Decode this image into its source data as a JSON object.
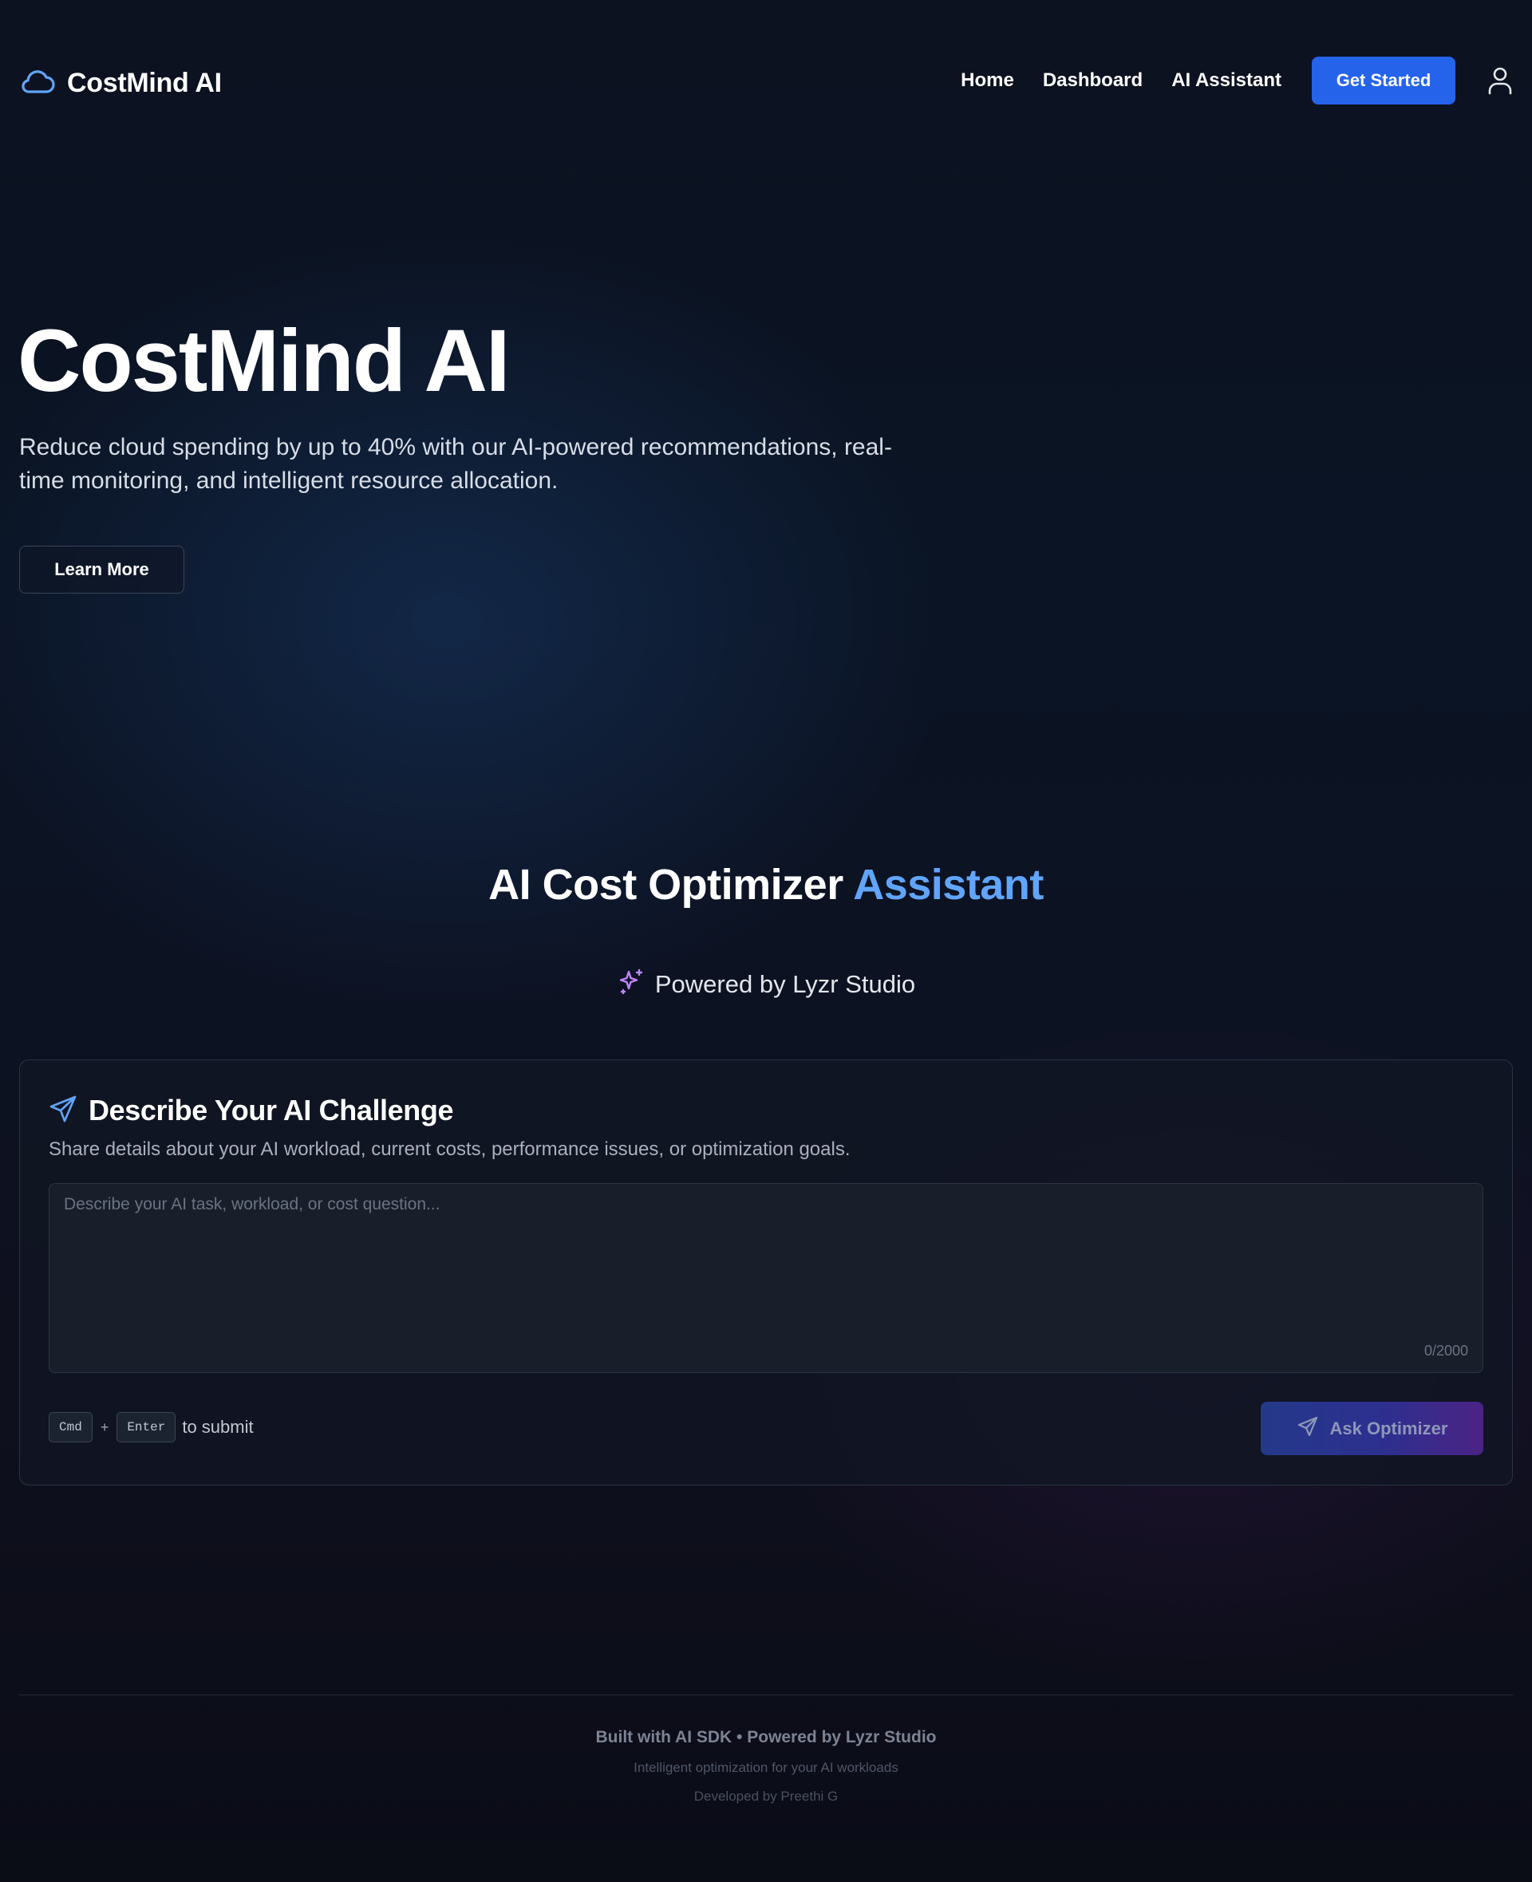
{
  "nav": {
    "brand_name": "CostMind AI",
    "brand_icon": "cloud-icon",
    "links": [
      "Home",
      "Dashboard",
      "AI Assistant"
    ],
    "cta_label": "Get Started",
    "user_icon": "user-icon"
  },
  "hero": {
    "title": "CostMind AI",
    "subtitle": "Reduce cloud spending by up to 40% with our AI-powered recommendations, real-time monitoring, and intelligent resource allocation.",
    "learn_more_label": "Learn More"
  },
  "assistant": {
    "title_main": "AI Cost Optimizer",
    "title_accent": "Assistant",
    "powered_by": "Powered by Lyzr Studio",
    "powered_icon": "sparkles-icon"
  },
  "card": {
    "icon": "send-icon",
    "title": "Describe Your AI Challenge",
    "description": "Share details about your AI workload, current costs, performance issues, or optimization goals.",
    "input_value": "",
    "input_placeholder": "Describe your AI task, workload, or cost question...",
    "counter": "0/2000",
    "shortcut_key1": "Cmd",
    "shortcut_plus": "+",
    "shortcut_key2": "Enter",
    "shortcut_suffix": "to submit",
    "submit_label": "Ask Optimizer"
  },
  "footer": {
    "main": "Built with AI SDK • Powered by Lyzr Studio",
    "tagline": "Intelligent optimization for your AI workloads",
    "developer": "Developed by Preethi G"
  },
  "colors": {
    "accent_blue": "#2563eb",
    "title_accent": "#60a5fa",
    "sparkle_purple": "#c084fc",
    "background": "#0b0f1a"
  }
}
